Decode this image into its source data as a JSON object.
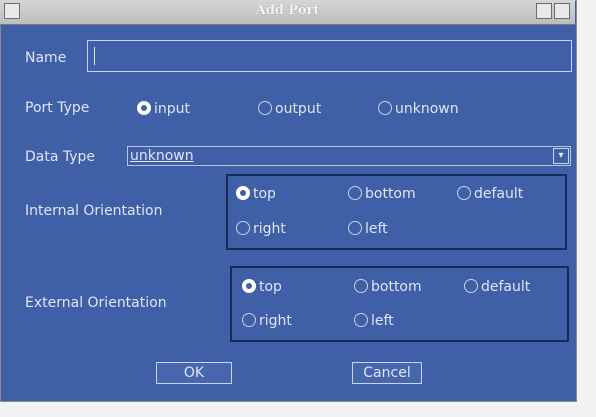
{
  "window": {
    "title": "Add Port"
  },
  "name": {
    "label": "Name",
    "value": ""
  },
  "port_type": {
    "label": "Port Type",
    "options": [
      {
        "label": "input",
        "selected": true
      },
      {
        "label": "output",
        "selected": false
      },
      {
        "label": "unknown",
        "selected": false
      }
    ]
  },
  "data_type": {
    "label": "Data Type",
    "value": "unknown"
  },
  "internal_orientation": {
    "label": "Internal Orientation",
    "options": [
      {
        "label": "top",
        "selected": true
      },
      {
        "label": "bottom",
        "selected": false
      },
      {
        "label": "default",
        "selected": false
      },
      {
        "label": "right",
        "selected": false
      },
      {
        "label": "left",
        "selected": false
      }
    ]
  },
  "external_orientation": {
    "label": "External Orientation",
    "options": [
      {
        "label": "top",
        "selected": true
      },
      {
        "label": "bottom",
        "selected": false
      },
      {
        "label": "default",
        "selected": false
      },
      {
        "label": "right",
        "selected": false
      },
      {
        "label": "left",
        "selected": false
      }
    ]
  },
  "buttons": {
    "ok": "OK",
    "cancel": "Cancel"
  },
  "colors": {
    "background": "#3f5fa6",
    "text": "#dfe6f6",
    "group_border": "#172a5a"
  }
}
